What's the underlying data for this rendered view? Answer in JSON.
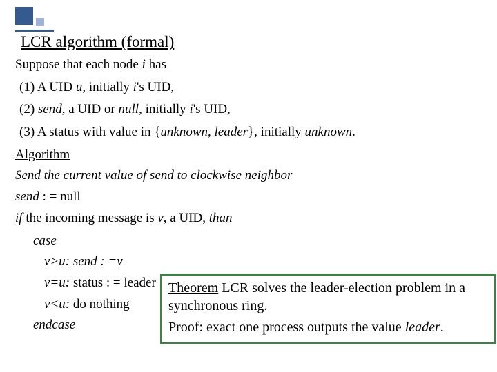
{
  "title": "LCR algorithm (formal)",
  "line_suppose_a": "Suppose that each node ",
  "line_suppose_i": "i",
  "line_suppose_b": " has",
  "item1_a": "(1)  A UID ",
  "item1_u": "u",
  "item1_b": ", initially ",
  "item1_i": "i",
  "item1_c": "'s UID",
  "item1_d": ",",
  "item2_a": "(2)  ",
  "item2_send": "send",
  "item2_b": ", a UID or ",
  "item2_null": "null",
  "item2_c": ", initially ",
  "item2_i": "i",
  "item2_d": "'s UID,",
  "item3_a": "(3)  A status with value in {",
  "item3_unk": "unknown, leader",
  "item3_b": "}, initially ",
  "item3_unk2": "unknown",
  "item3_c": ".",
  "algo_label": "Algorithm",
  "send_line_a": "Send  the current value of send to clockwise neighbor",
  "assign_a": "send",
  "assign_b": " : = null",
  "if_a": "if",
  "if_b": " the incoming message is ",
  "if_v": "v",
  "if_c": ", a UID, ",
  "if_than": "than",
  "case": "case",
  "c1_a": "v>u: send : =v",
  "c2_a": "v=u:",
  "c2_b": " status : = leader",
  "c3_a": "v<u:",
  "c3_b": " do nothing",
  "endcase": "endcase",
  "thm_a": "Theorem",
  "thm_b": "  LCR solves the leader-election problem in a synchronous ring.",
  "proof_a": "Proof: exact one process outputs the value ",
  "proof_b": "leader",
  "proof_c": "."
}
